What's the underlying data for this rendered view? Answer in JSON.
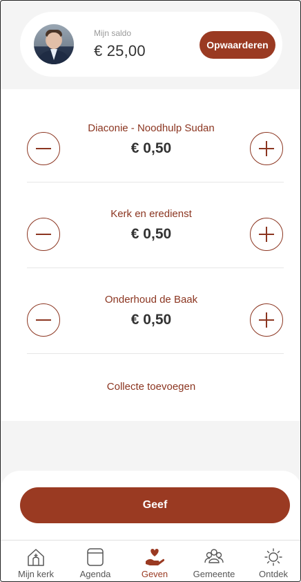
{
  "header": {
    "balance_label": "Mijn saldo",
    "balance_value": "€ 25,00",
    "topup_label": "Opwaarderen"
  },
  "collections": [
    {
      "title": "Diaconie - Noodhulp Sudan",
      "amount": "€ 0,50"
    },
    {
      "title": "Kerk en eredienst",
      "amount": "€ 0,50"
    },
    {
      "title": "Onderhoud de Baak",
      "amount": "€ 0,50"
    }
  ],
  "add_collection_label": "Collecte toevoegen",
  "give_label": "Geef",
  "tabs": [
    {
      "label": "Mijn kerk",
      "icon": "church-home-icon",
      "active": false
    },
    {
      "label": "Agenda",
      "icon": "calendar-icon",
      "active": false
    },
    {
      "label": "Geven",
      "icon": "giving-hand-heart-icon",
      "active": true
    },
    {
      "label": "Gemeente",
      "icon": "people-group-icon",
      "active": false
    },
    {
      "label": "Ontdek",
      "icon": "sun-icon",
      "active": false
    }
  ],
  "colors": {
    "accent": "#9a3a22",
    "accent_text": "#8b3520",
    "background": "#f4f4f4"
  }
}
